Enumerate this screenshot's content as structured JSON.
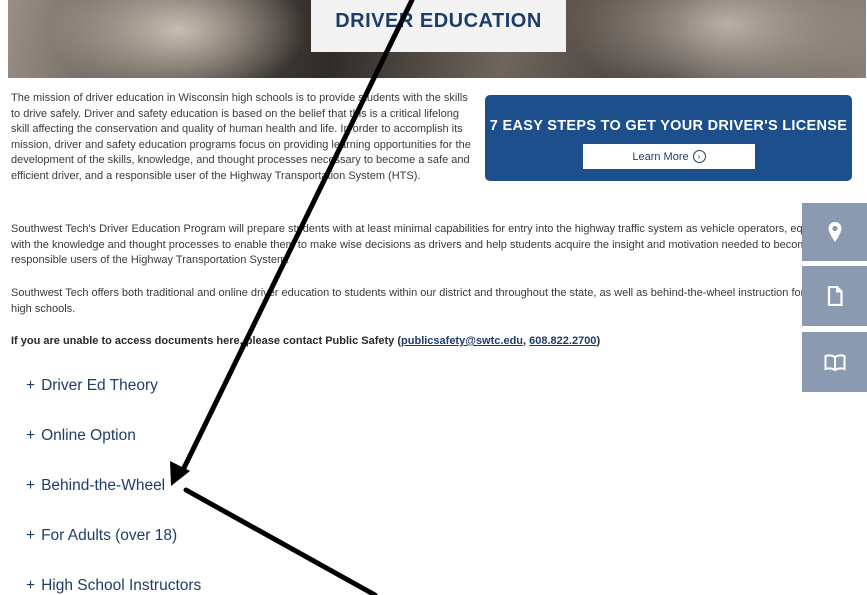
{
  "hero": {
    "title": "DRIVER EDUCATION"
  },
  "intro": {
    "paragraph1": "The mission of driver education in Wisconsin high schools is to provide students with the skills to drive safely. Driver and safety education is based on the belief that this is a critical lifelong skill affecting the conservation and quality of human health and life. In order to accomplish its mission, driver and safety education programs focus on providing learning opportunities for the development of the skills, knowledge, and thought processes necessary to become a safe and efficient driver, and a responsible user of the Highway Transportation System (HTS).",
    "paragraph2": "Southwest Tech's Driver Education Program will prepare students with at least minimal capabilities for entry into the highway traffic system as vehicle operators, equip students with the knowledge and thought processes to enable them to make wise decisions as drivers and help students acquire the insight and motivation needed to become responsible users of the Highway Transportation System.",
    "paragraph3": "Southwest Tech offers both traditional and online driver education to students within our district and throughout the state, as well as behind-the-wheel instruction for our district high schools.",
    "contact_prefix": "If you are unable to access documents here, please contact Public Safety (",
    "contact_email": "publicsafety@swtc.edu",
    "contact_sep": ", ",
    "contact_phone": "608.822.2700",
    "contact_suffix": ")"
  },
  "cta": {
    "title": "7 EASY STEPS TO GET YOUR DRIVER'S LICENSE",
    "button_label": "Learn More",
    "button_icon": "›"
  },
  "side_buttons": [
    {
      "icon": "map-pin-icon"
    },
    {
      "icon": "document-icon"
    },
    {
      "icon": "book-icon"
    }
  ],
  "accordion": [
    {
      "symbol": "+",
      "label": "Driver Ed Theory"
    },
    {
      "symbol": "+",
      "label": "Online Option"
    },
    {
      "symbol": "+",
      "label": "Behind-the-Wheel"
    },
    {
      "symbol": "+",
      "label": "For Adults (over 18)"
    },
    {
      "symbol": "+",
      "label": "High School Instructors"
    }
  ],
  "colors": {
    "brand_blue": "#1d4f8c",
    "heading_navy": "#1f3d6b",
    "side_button": "#8a9ab0",
    "annotation_arrow": "#000000"
  }
}
